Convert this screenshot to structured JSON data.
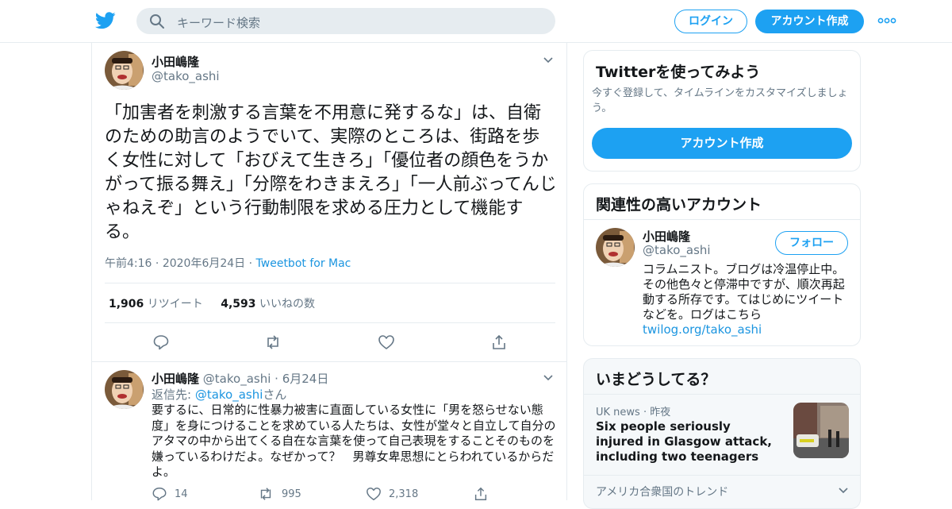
{
  "header": {
    "search_placeholder": "キーワード検索",
    "login_label": "ログイン",
    "signup_label": "アカウント作成"
  },
  "tweet": {
    "author_name": "小田嶋隆",
    "author_handle": "@tako_ashi",
    "text": "「加害者を刺激する言葉を不用意に発するな」は、自衛のための助言のようでいて、実際のところは、街路を歩く女性に対して「おびえて生きろ」「優位者の顔色をうかがって振る舞え」「分際をわきまえろ」「一人前ぶってんじゃねえぞ」という行動制限を求める圧力として機能する。",
    "time": "午前4:16",
    "date": "2020年6月24日",
    "source": "Tweetbot for Mac",
    "retweet_count": "1,906",
    "retweet_label": "リツイート",
    "like_count": "4,593",
    "like_label": "いいねの数"
  },
  "reply": {
    "author_name": "小田嶋隆",
    "author_handle": "@tako_ashi",
    "date": "6月24日",
    "reply_to_prefix": "返信先: ",
    "reply_to_handle": "@tako_ashi",
    "reply_to_suffix": "さん",
    "text": "要するに、日常的に性暴力被害に直面している女性に「男を怒らせない態度」を身につけることを求めている人たちは、女性が堂々と自立して自分のアタマの中から出てくる自在な言葉を使って自己表現をすることそのものを嫌っているわけだよ。なぜかって？　男尊女卑思想にとらわれているからだよ。",
    "reply_count": "14",
    "retweet_count": "995",
    "like_count": "2,318"
  },
  "signup_card": {
    "title": "Twitterを使ってみよう",
    "description": "今すぐ登録して、タイムラインをカスタマイズしましょう。",
    "button_label": "アカウント作成"
  },
  "related_card": {
    "title": "関連性の高いアカウント",
    "name": "小田嶋隆",
    "handle": "@tako_ashi",
    "follow_label": "フォロー",
    "bio": "コラムニスト。ブログは冷温停止中。その他色々と停滞中ですが、順次再起動する所存です。てはじめにツイートなどを。ログはこちら",
    "bio_link": "twilog.org/tako_ashi"
  },
  "trends_card": {
    "title": "いまどうしてる？",
    "trend_source": "UK news",
    "trend_time": "昨夜",
    "trend_title": "Six people seriously injured in Glasgow attack, including two teenagers",
    "location_label": "アメリカ合衆国のトレンド"
  },
  "colors": {
    "accent": "#1da1f2",
    "link": "#1b95e0",
    "secondary_text": "#657786",
    "border": "#e6ecf0"
  }
}
